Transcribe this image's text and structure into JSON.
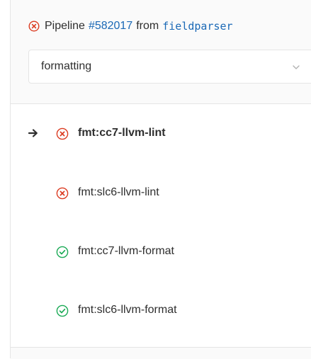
{
  "header": {
    "status_icon": "failed-status-icon",
    "pipeline_label": "Pipeline",
    "pipeline_id": "#582017",
    "from_label": "from",
    "branch": "fieldparser"
  },
  "stage_select": {
    "value": "formatting",
    "icon": "chevron-down-icon"
  },
  "jobs": [
    {
      "name": "fmt:cc7-llvm-lint",
      "status": "failed",
      "active": true
    },
    {
      "name": "fmt:slc6-llvm-lint",
      "status": "failed",
      "active": false
    },
    {
      "name": "fmt:cc7-llvm-format",
      "status": "success",
      "active": false
    },
    {
      "name": "fmt:slc6-llvm-format",
      "status": "success",
      "active": false
    }
  ],
  "colors": {
    "failed": "#db3b21",
    "success": "#1aaa55",
    "link": "#1b69b6"
  }
}
